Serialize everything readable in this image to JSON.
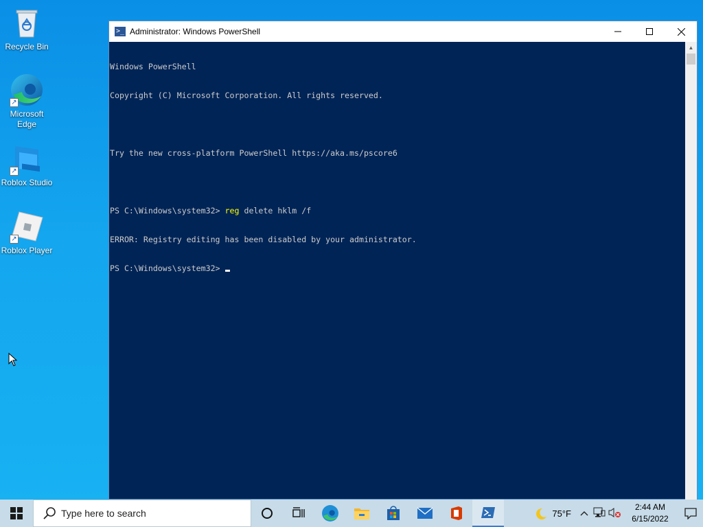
{
  "desktop": {
    "icons": [
      {
        "label": "Recycle Bin"
      },
      {
        "label": "Microsoft Edge"
      },
      {
        "label": "Roblox Studio"
      },
      {
        "label": "Roblox Player"
      }
    ]
  },
  "window": {
    "title": "Administrator: Windows PowerShell",
    "minimize_icon": "minimize-icon",
    "maximize_icon": "maximize-icon",
    "close_icon": "close-icon"
  },
  "console": {
    "lines": [
      "Windows PowerShell",
      "Copyright (C) Microsoft Corporation. All rights reserved.",
      "",
      "Try the new cross-platform PowerShell https://aka.ms/pscore6",
      "",
      {
        "prompt": "PS C:\\Windows\\system32> ",
        "command": "reg",
        "args": " delete hklm /f"
      },
      "ERROR: Registry editing has been disabled by your administrator.",
      {
        "prompt": "PS C:\\Windows\\system32> "
      }
    ]
  },
  "taskbar": {
    "search_placeholder": "Type here to search",
    "pinned": [
      "cortana-icon",
      "task-view-icon",
      "edge-icon",
      "file-explorer-icon",
      "store-icon",
      "mail-icon",
      "office-icon",
      "powershell-icon"
    ],
    "weather": "75°F",
    "time": "2:44 AM",
    "date": "6/15/2022"
  },
  "colors": {
    "console_bg": "#012456",
    "console_fg": "#cccccc",
    "command_fg": "#ffff00",
    "desktop": "#18b2f2"
  }
}
